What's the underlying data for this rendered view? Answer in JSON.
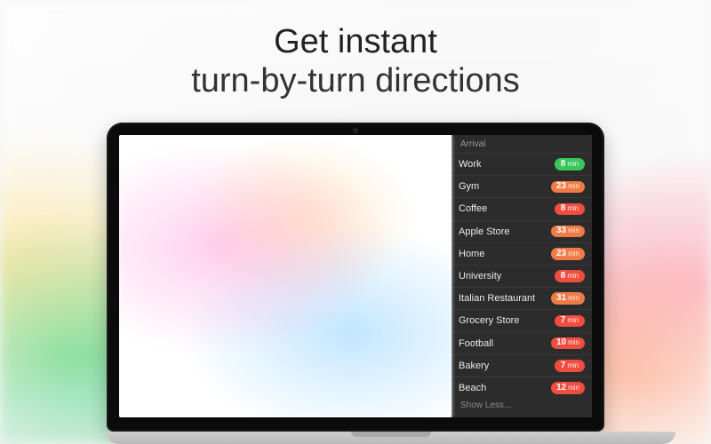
{
  "headline": {
    "line1": "Get instant",
    "line2": "turn-by-turn directions"
  },
  "sidebar": {
    "header": "Arrival",
    "unit": "min",
    "show_less": "Show Less...",
    "colors": {
      "green": "#3bc65a",
      "orange": "#ef7b46",
      "red": "#ef4d3f"
    },
    "destinations": [
      {
        "label": "Work",
        "minutes": 8,
        "color": "green"
      },
      {
        "label": "Gym",
        "minutes": 23,
        "color": "orange"
      },
      {
        "label": "Coffee",
        "minutes": 8,
        "color": "red"
      },
      {
        "label": "Apple Store",
        "minutes": 33,
        "color": "orange"
      },
      {
        "label": "Home",
        "minutes": 23,
        "color": "orange"
      },
      {
        "label": "University",
        "minutes": 8,
        "color": "red"
      },
      {
        "label": "Italian Restaurant",
        "minutes": 31,
        "color": "orange"
      },
      {
        "label": "Grocery Store",
        "minutes": 7,
        "color": "red"
      },
      {
        "label": "Football",
        "minutes": 10,
        "color": "red"
      },
      {
        "label": "Bakery",
        "minutes": 7,
        "color": "red"
      },
      {
        "label": "Beach",
        "minutes": 12,
        "color": "red"
      }
    ]
  }
}
